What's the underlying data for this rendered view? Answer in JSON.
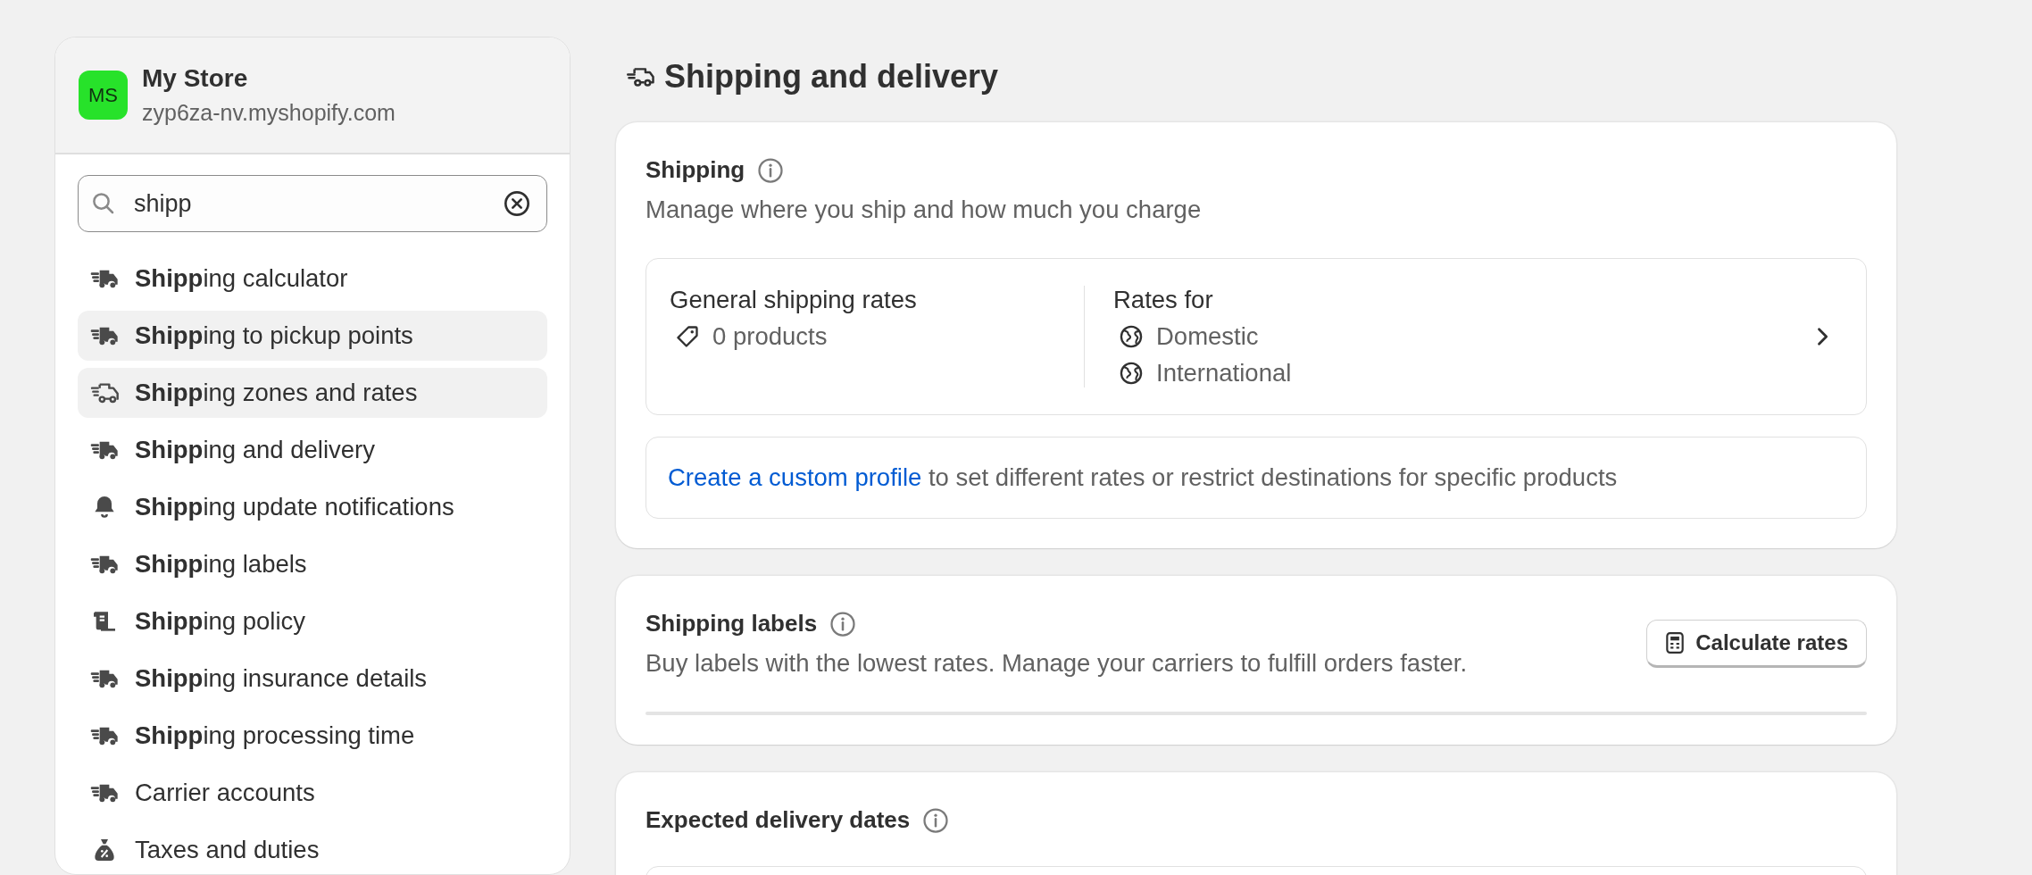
{
  "sidebar": {
    "store": {
      "initials": "MS",
      "name": "My Store",
      "domain": "zyp6za-nv.myshopify.com"
    },
    "search": {
      "value": "shipp"
    },
    "results": [
      {
        "label": "**Shipp**ing calculator",
        "kind": "truck",
        "selected": false
      },
      {
        "label": "**Shipp**ing to pickup points",
        "kind": "truck",
        "selected": true
      },
      {
        "label": "**Shipp**ing zones and rates",
        "kind": "truck-outline",
        "selected": true
      },
      {
        "label": "**Shipp**ing and delivery",
        "kind": "truck",
        "selected": false
      },
      {
        "label": "**Shipp**ing update notifications",
        "kind": "bell",
        "selected": false
      },
      {
        "label": "**Shipp**ing labels",
        "kind": "truck",
        "selected": false
      },
      {
        "label": "**Shipp**ing policy",
        "kind": "scroll",
        "selected": false
      },
      {
        "label": "**Shipp**ing insurance details",
        "kind": "truck",
        "selected": false
      },
      {
        "label": "**Shipp**ing processing time",
        "kind": "truck",
        "selected": false
      },
      {
        "label": "Carrier accounts",
        "kind": "truck",
        "selected": false
      },
      {
        "label": "Taxes and duties",
        "kind": "bag",
        "selected": false
      }
    ]
  },
  "page": {
    "title": "Shipping and delivery",
    "shipping": {
      "title": "Shipping",
      "description": "Manage where you ship and how much you charge",
      "profile": {
        "name": "General shipping rates",
        "products": "0 products",
        "rates_label": "Rates for",
        "zones": [
          "Domestic",
          "International"
        ]
      },
      "custom": {
        "link": "Create a custom profile",
        "rest": "to set different rates or restrict destinations for specific products"
      }
    },
    "labels": {
      "title": "Shipping labels",
      "description": "Buy labels with the lowest rates. Manage your carriers to fulfill orders faster.",
      "button": "Calculate rates"
    },
    "delivery": {
      "title": "Expected delivery dates"
    }
  }
}
